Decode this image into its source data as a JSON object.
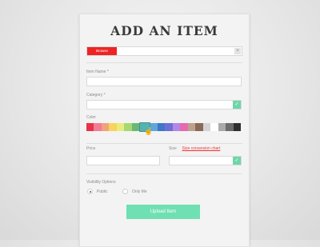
{
  "form": {
    "title": "ADD AN ITEM",
    "browse_label": "Browse",
    "clear_icon": "close-icon",
    "item_name_label": "Item Name *",
    "category_label": "Category *",
    "color_label": "Color",
    "price_label": "Price",
    "size_label": "Size",
    "size_chart_link": "Size conversion chart",
    "visibility_label": "Visibility Options",
    "visibility_options": [
      "Public",
      "Only Me"
    ],
    "visibility_selected": "Public",
    "upload_label": "Upload Item"
  },
  "palette": [
    "#e8324a",
    "#f27c96",
    "#f3a17a",
    "#f7d45e",
    "#e9eb7c",
    "#a6d873",
    "#6ab873",
    "#53b3b3",
    "#5fa7d9",
    "#3f76c9",
    "#6d6fd6",
    "#b287e6",
    "#e46ab1",
    "#bfa08d",
    "#8a6a57",
    "#d4d4d4",
    "#ffffff",
    "#a9a9a9",
    "#6b6b6b",
    "#2e2e2e"
  ],
  "palette_selected_index": 7,
  "colors": {
    "accent": "#ee2424",
    "button": "#6fe0b2",
    "select_arrow": "#6fd6a9"
  }
}
